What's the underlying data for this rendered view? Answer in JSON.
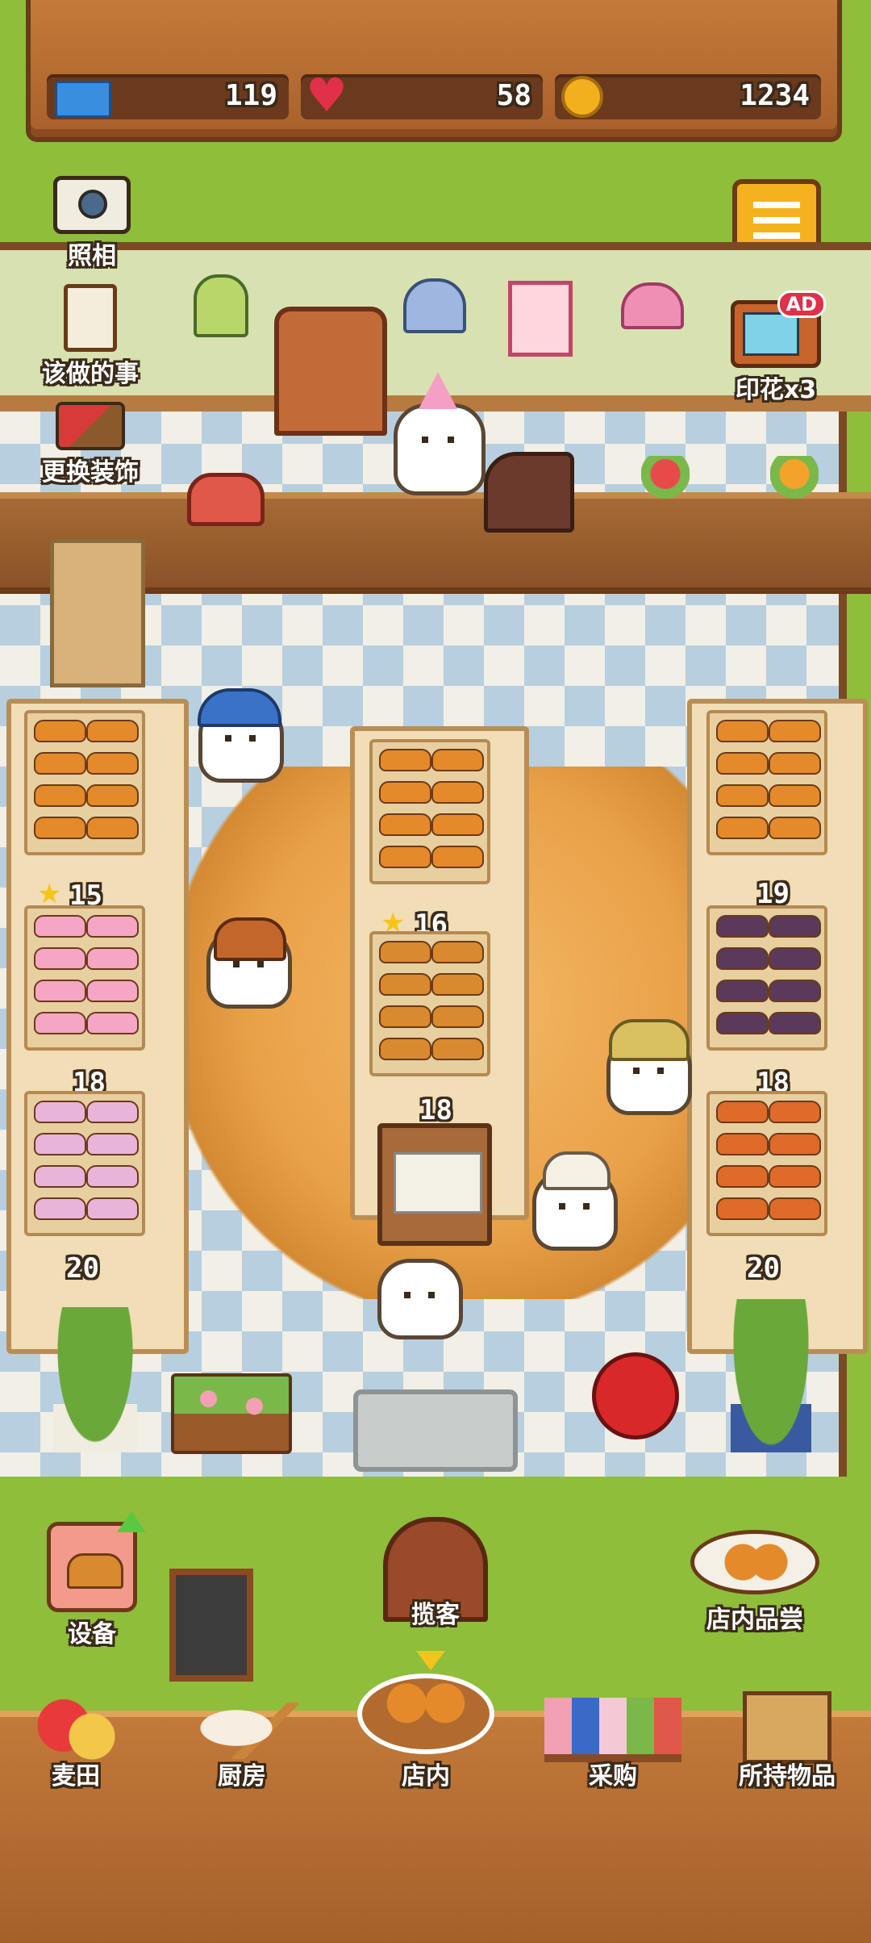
{
  "stats": {
    "tickets": "119",
    "hearts": "58",
    "coins": "1234"
  },
  "side_buttons": {
    "camera": "照相",
    "todo": "该做的事",
    "decor": "更换装饰",
    "stamp": "印花x3",
    "ad_badge": "AD"
  },
  "shelves": {
    "left": [
      "15",
      "18",
      "20"
    ],
    "middle": [
      "16",
      "18"
    ],
    "right": [
      "19",
      "18",
      "20"
    ]
  },
  "actions": {
    "equipment": "设备",
    "solicit": "揽客",
    "tasting": "店内品尝"
  },
  "nav": {
    "items": [
      "麦田",
      "厨房",
      "店内",
      "采购",
      "所持物品"
    ]
  },
  "colors": {
    "grass": "#8fbe3a",
    "wood": "#a8612b",
    "menu_button": "#f5b21e",
    "heart": "#e0304a",
    "coin": "#f2b01e",
    "ticket": "#3a8ee0"
  }
}
